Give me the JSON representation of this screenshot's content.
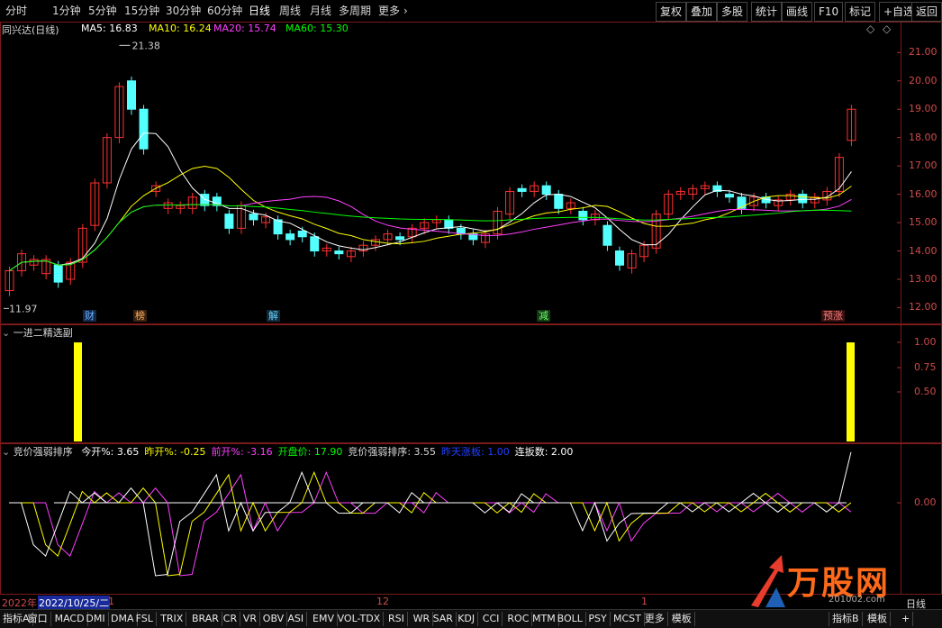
{
  "toolbar": {
    "periods": [
      "分时",
      "1分钟",
      "5分钟",
      "15分钟",
      "30分钟",
      "60分钟",
      "日线",
      "周线",
      "月线",
      "多周期",
      "更多"
    ],
    "active_period": "日线",
    "more_arrow": "›",
    "right_buttons": [
      "复权",
      "叠加",
      "多股",
      "统计",
      "画线",
      "F10",
      "标记",
      "+自选",
      "返回"
    ]
  },
  "main_panel": {
    "stock_title": "同兴达(日线)",
    "ma_labels": [
      {
        "text": "MA5: 16.83",
        "color": "#ffffff"
      },
      {
        "text": "MA10: 16.24",
        "color": "#ffff00"
      },
      {
        "text": "MA20: 15.74",
        "color": "#ff40ff"
      },
      {
        "text": "MA60: 15.30",
        "color": "#00ff00"
      }
    ],
    "high_marker": "21.38",
    "low_marker": "11.97",
    "y_ticks": [
      "21.00",
      "20.00",
      "19.00",
      "18.00",
      "17.00",
      "16.00",
      "15.00",
      "14.00",
      "13.00",
      "12.00"
    ],
    "y_range": [
      11.6,
      21.9
    ],
    "badges": [
      {
        "text": "财",
        "color": "#66b3ff",
        "bg": "#14284a"
      },
      {
        "text": "榜",
        "color": "#ffb060",
        "bg": "#3a2210"
      },
      {
        "text": "解",
        "color": "#66d0ff",
        "bg": "#102a3a"
      },
      {
        "text": "减",
        "color": "#70ff70",
        "bg": "#103a10"
      },
      {
        "text": "预涨",
        "color": "#ff8080",
        "bg": "#3a1010"
      }
    ],
    "up_color": "#ff3030",
    "down_color": "#54ffff"
  },
  "chart_data": {
    "type": "candlestick",
    "candles": [
      [
        12.6,
        13.3,
        12.1,
        12.0
      ],
      [
        13.3,
        13.9,
        13.0,
        13.0
      ],
      [
        13.5,
        13.7,
        13.2,
        13.2
      ],
      [
        13.2,
        13.7,
        12.9,
        13.5
      ],
      [
        13.5,
        12.9,
        12.8,
        12.8
      ],
      [
        13.0,
        13.6,
        12.9,
        12.9
      ],
      [
        13.6,
        14.8,
        13.5,
        13.4
      ],
      [
        14.9,
        16.4,
        14.7,
        14.7
      ],
      [
        16.4,
        18.0,
        16.2,
        16.1
      ],
      [
        18.0,
        19.8,
        17.8,
        17.8
      ],
      [
        20.0,
        19.0,
        18.8,
        18.8
      ],
      [
        19.0,
        17.6,
        17.4,
        17.0
      ],
      [
        16.1,
        16.3,
        16.0,
        15.8
      ],
      [
        15.5,
        15.7,
        15.4,
        15.4
      ],
      [
        15.5,
        15.6,
        15.3,
        15.3
      ],
      [
        15.5,
        15.9,
        15.3,
        15.3
      ],
      [
        16.0,
        15.6,
        15.5,
        15.4
      ],
      [
        15.9,
        15.6,
        15.4,
        15.3
      ],
      [
        15.3,
        14.8,
        14.8,
        14.7
      ],
      [
        14.8,
        15.6,
        14.7,
        14.7
      ],
      [
        15.3,
        15.1,
        15.1,
        15.0
      ],
      [
        15.0,
        15.2,
        14.9,
        14.9
      ],
      [
        15.1,
        14.6,
        14.5,
        14.5
      ],
      [
        14.6,
        14.4,
        14.4,
        14.3
      ],
      [
        14.7,
        14.5,
        14.5,
        14.4
      ],
      [
        14.5,
        14.0,
        13.8,
        13.7
      ],
      [
        14.0,
        14.1,
        13.9,
        13.9
      ],
      [
        14.0,
        13.9,
        13.9,
        13.8
      ],
      [
        13.8,
        14.0,
        13.7,
        13.7
      ],
      [
        14.0,
        14.2,
        13.9,
        13.8
      ],
      [
        14.2,
        14.4,
        14.1,
        14.1
      ],
      [
        14.4,
        14.6,
        14.3,
        14.3
      ],
      [
        14.5,
        14.4,
        14.3,
        14.3
      ],
      [
        14.5,
        14.8,
        14.4,
        14.4
      ],
      [
        14.8,
        15.0,
        14.7,
        14.6
      ],
      [
        15.0,
        15.1,
        14.9,
        14.9
      ],
      [
        15.1,
        14.8,
        14.7,
        14.7
      ],
      [
        14.8,
        14.6,
        14.6,
        14.5
      ],
      [
        14.6,
        14.4,
        14.3,
        14.3
      ],
      [
        14.3,
        14.6,
        14.2,
        14.2
      ],
      [
        14.6,
        15.4,
        14.5,
        14.5
      ],
      [
        15.3,
        16.1,
        15.2,
        15.2
      ],
      [
        16.2,
        16.1,
        16.0,
        15.9
      ],
      [
        16.1,
        16.3,
        16.0,
        15.8
      ],
      [
        16.3,
        16.0,
        15.8,
        15.8
      ],
      [
        16.0,
        15.5,
        15.2,
        15.2
      ],
      [
        15.5,
        15.7,
        15.4,
        15.4
      ],
      [
        15.4,
        15.1,
        14.9,
        14.8
      ],
      [
        15.1,
        15.3,
        15.0,
        14.9
      ],
      [
        14.9,
        14.2,
        14.0,
        14.0
      ],
      [
        14.0,
        13.5,
        13.4,
        13.4
      ],
      [
        13.4,
        13.9,
        13.3,
        13.3
      ],
      [
        13.8,
        14.2,
        13.7,
        13.7
      ],
      [
        14.1,
        15.3,
        14.0,
        14.0
      ],
      [
        15.3,
        16.0,
        15.2,
        15.2
      ],
      [
        16.0,
        16.1,
        15.9,
        15.9
      ],
      [
        16.0,
        16.2,
        15.9,
        15.9
      ],
      [
        16.2,
        16.3,
        16.1,
        16.0
      ],
      [
        16.3,
        16.1,
        15.9,
        15.9
      ],
      [
        16.0,
        15.9,
        15.8,
        15.8
      ],
      [
        15.9,
        15.5,
        15.4,
        15.4
      ],
      [
        15.6,
        15.9,
        15.5,
        15.5
      ],
      [
        15.9,
        15.7,
        15.5,
        15.5
      ],
      [
        15.6,
        15.8,
        15.5,
        15.5
      ],
      [
        15.8,
        16.0,
        15.7,
        15.7
      ],
      [
        16.0,
        15.7,
        15.6,
        15.6
      ],
      [
        15.7,
        15.9,
        15.6,
        15.6
      ],
      [
        15.8,
        16.1,
        15.7,
        15.7
      ],
      [
        16.1,
        17.3,
        16.0,
        16.0
      ],
      [
        17.9,
        19.0,
        17.8,
        17.8
      ]
    ],
    "ma": {
      "ma5_color": "#ffffff",
      "ma10_color": "#ffff00",
      "ma20_color": "#ff40ff",
      "ma60_color": "#00ff00"
    }
  },
  "sub_panel1": {
    "title": "一进二精选副",
    "y_ticks": [
      "1.00",
      "0.75",
      "0.50"
    ],
    "signal_bars": [
      {
        "index": 0,
        "value": 1.0
      },
      {
        "index": 1,
        "value": 1.0
      }
    ],
    "bar_color": "#ffff00"
  },
  "sub_panel2": {
    "title": "竞价强弱排序",
    "fields": [
      {
        "text": "今开%: 3.65",
        "color": "#ffffff"
      },
      {
        "text": "昨开%: -0.25",
        "color": "#ffff00"
      },
      {
        "text": "前开%: -3.16",
        "color": "#ff40ff"
      },
      {
        "text": "开盘价: 17.90",
        "color": "#00ff00"
      },
      {
        "text": "竞价强弱排序: 3.55",
        "color": "#d8d8d8"
      },
      {
        "text": "昨天涨板: 1.00",
        "color": "#2040ff"
      },
      {
        "text": "连扳数: 2.00",
        "color": "#ffffff"
      }
    ],
    "y_ticks": [
      "0.00"
    ]
  },
  "date_axis": {
    "year": "2022年",
    "cursor_date": "2022/10/25/二",
    "ticks": [
      "1",
      "12",
      "1"
    ],
    "period_label": "日线"
  },
  "watermark": {
    "text": "万股网",
    "url_text": "201002.com"
  },
  "indicator_tabs": [
    "指标A",
    "窗口",
    "MACD",
    "DMI",
    "DMA",
    "FSL",
    "TRIX",
    "BRAR",
    "CR",
    "VR",
    "OBV",
    "ASI",
    "EMV",
    "VOL-TDX",
    "RSI",
    "WR",
    "SAR",
    "KDJ",
    "CCI",
    "ROC",
    "MTM",
    "BOLL",
    "PSY",
    "MCST",
    "更多",
    "模板"
  ],
  "indicator_right": {
    "label1": "指标B",
    "label2": "模板",
    "plus": "+"
  }
}
